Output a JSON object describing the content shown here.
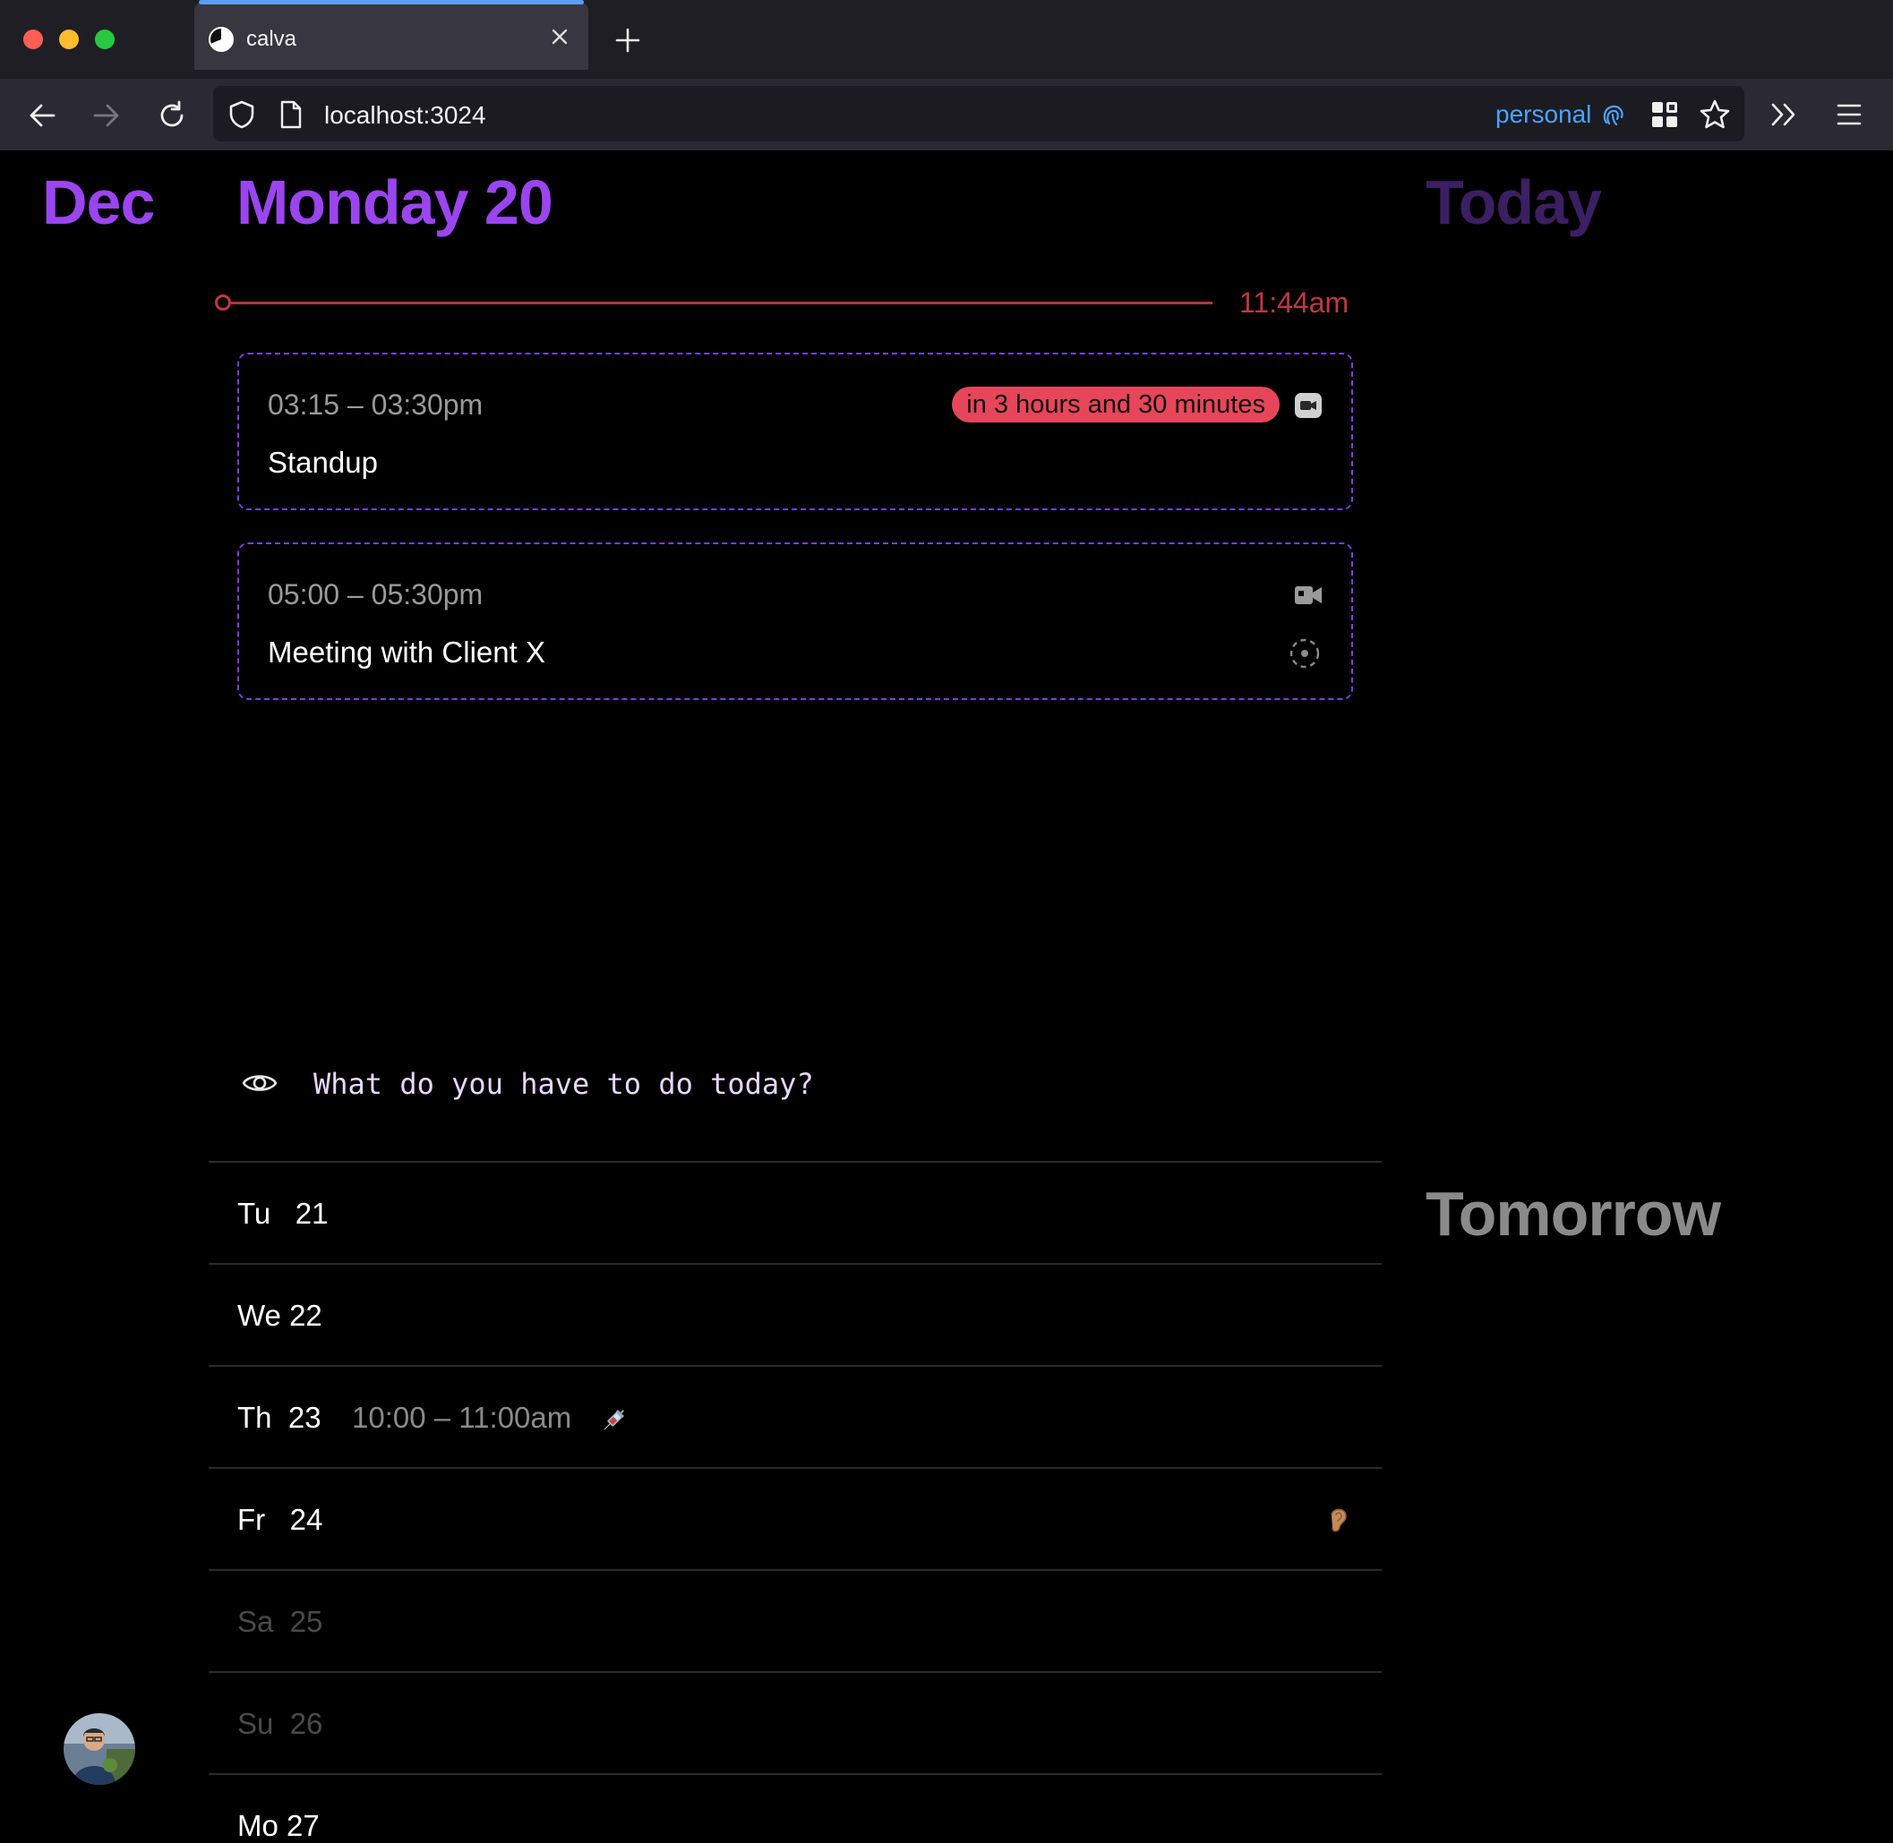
{
  "browser": {
    "tab_title": "calva",
    "url": "localhost:3024",
    "container_label": "personal",
    "colors": {
      "tab_accent": "#5b9df6",
      "container": "#4aa3ff"
    }
  },
  "header": {
    "month": "Dec",
    "day_title": "Monday 20",
    "today_label": "Today",
    "tomorrow_label": "Tomorrow"
  },
  "now": {
    "time": "11:44am",
    "color": "#c0383f"
  },
  "events": [
    {
      "time": "03:15 – 03:30pm",
      "title": "Standup",
      "badge": "in 3 hours and 30 minutes",
      "icon": "video-call-icon"
    },
    {
      "time": "05:00 – 05:30pm",
      "title": "Meeting with Client X",
      "icon": "video-call-icon",
      "icon2": "join-dashed-circle-icon"
    }
  ],
  "todo": {
    "placeholder": "What do you have to do today?",
    "icon": "eye-icon"
  },
  "days": [
    {
      "label": "Tu   21"
    },
    {
      "label": "We 22"
    },
    {
      "label": "Th  23",
      "time": "10:00 – 11:00am",
      "icon": "syringe-icon"
    },
    {
      "label": "Fr   24",
      "icon": "ear-icon"
    },
    {
      "label": "Sa  25",
      "muted": true
    },
    {
      "label": "Su  26",
      "muted": true
    },
    {
      "label": "Mo 27"
    }
  ],
  "colors": {
    "accent": "#9b45f0",
    "event_border": "#7a3fe0",
    "badge": "#e7465a"
  }
}
